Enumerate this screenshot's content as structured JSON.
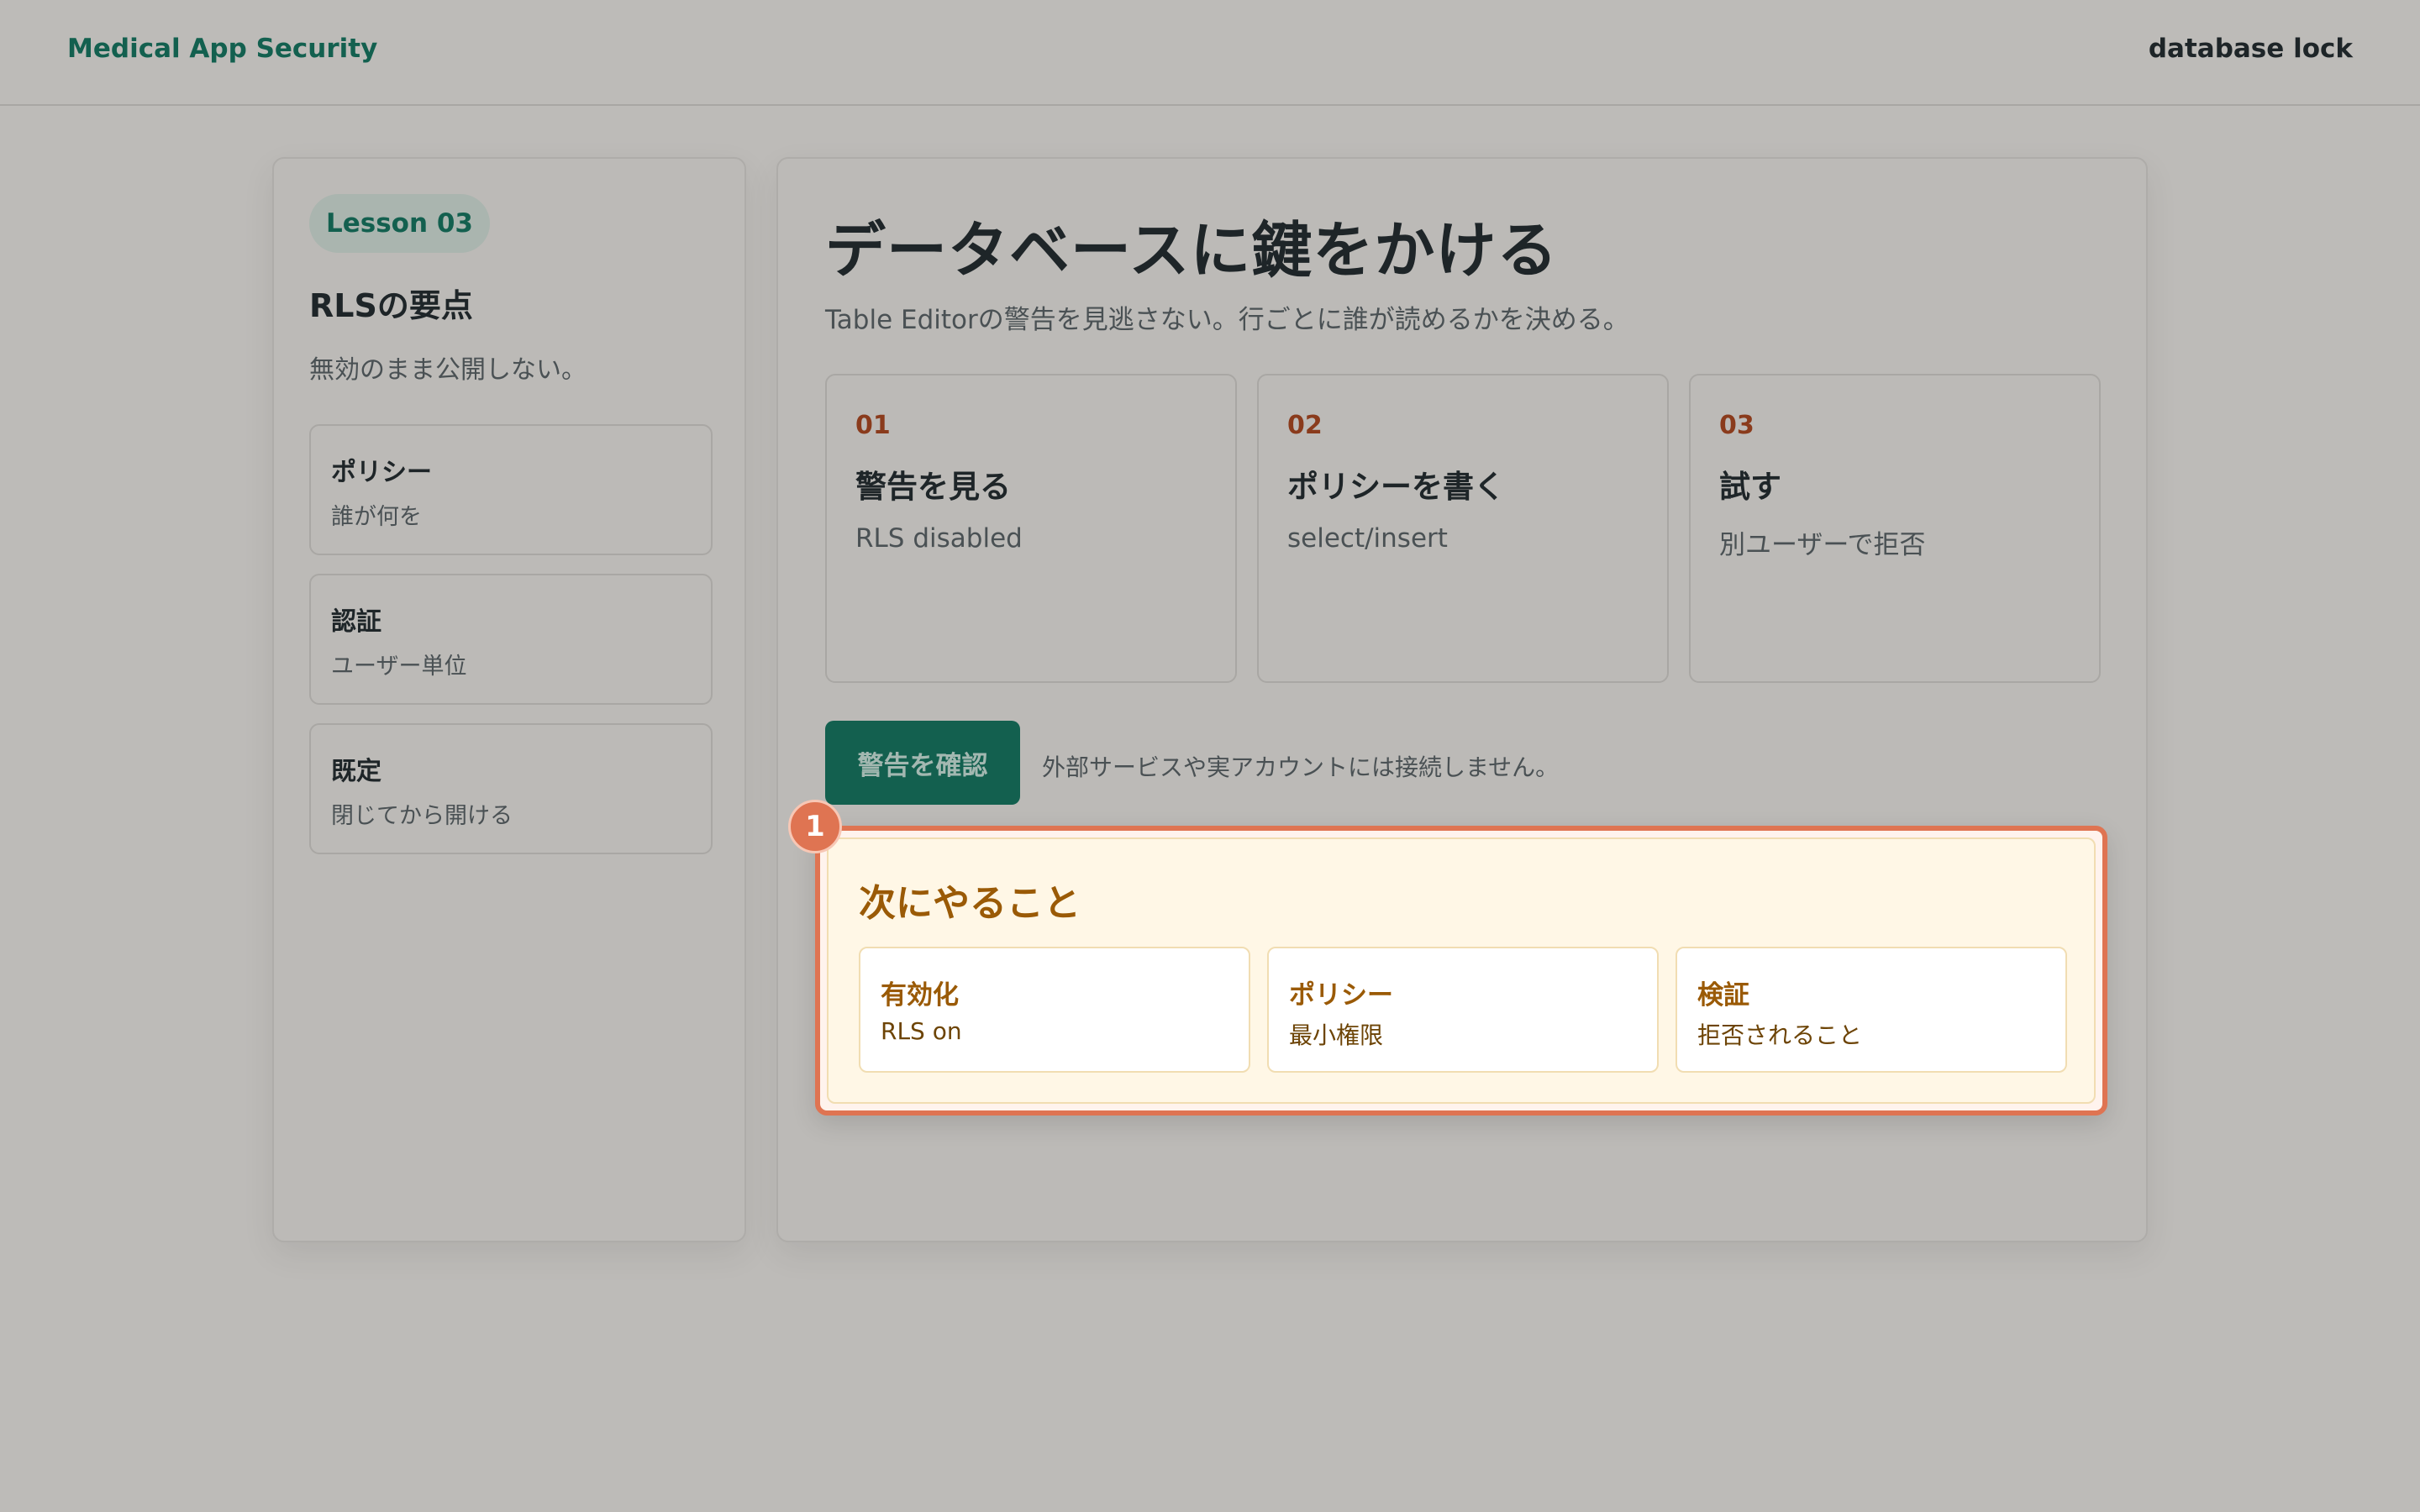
{
  "header": {
    "brand": "Medical App Security",
    "right_label": "database lock"
  },
  "sidebar": {
    "lesson": "Lesson 03",
    "title": "RLSの要点",
    "subtitle": "無効のまま公開しない。",
    "cards": [
      {
        "title": "ポリシー",
        "sub": "誰が何を"
      },
      {
        "title": "認証",
        "sub": "ユーザー単位"
      },
      {
        "title": "既定",
        "sub": "閉じてから開ける"
      }
    ]
  },
  "main": {
    "title": "データベースに鍵をかける",
    "subtitle": "Table Editorの警告を見逃さない。行ごとに誰が読めるかを決める。",
    "steps": [
      {
        "num": "01",
        "title": "警告を見る",
        "sub": "RLS disabled"
      },
      {
        "num": "02",
        "title": "ポリシーを書く",
        "sub": "select/insert"
      },
      {
        "num": "03",
        "title": "試す",
        "sub": "別ユーザーで拒否"
      }
    ],
    "confirm_button": "警告を確認",
    "note": "外部サービスや実アカウントには接続しません。"
  },
  "next": {
    "badge": "1",
    "title": "次にやること",
    "cards": [
      {
        "title": "有効化",
        "sub": "RLS on"
      },
      {
        "title": "ポリシー",
        "sub": "最小権限"
      },
      {
        "title": "検証",
        "sub": "拒否されること"
      }
    ]
  },
  "colors": {
    "accent": "#13604f",
    "highlight": "#df7452",
    "step_number": "#8a3b1c",
    "next_title": "#9a5a06"
  }
}
